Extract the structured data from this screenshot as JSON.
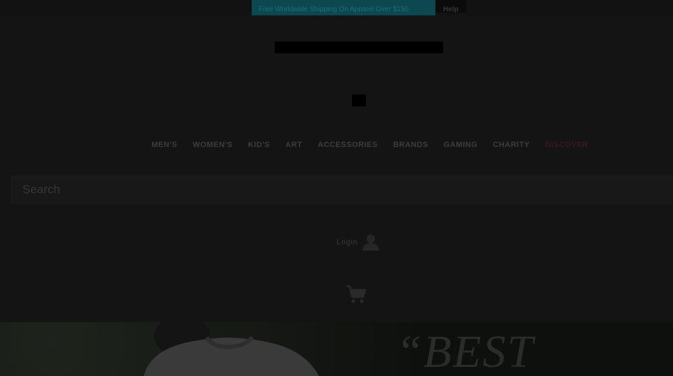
{
  "promo": {
    "text": "Free Worldwide Shipping On Apparel Over $150",
    "help_label": "Help"
  },
  "nav": {
    "items": [
      "MEN'S",
      "WOMEN'S",
      "KID'S",
      "ART",
      "ACCESSORIES",
      "BRANDS",
      "GAMING",
      "CHARITY",
      "DISCOVER"
    ]
  },
  "search": {
    "placeholder": "Search"
  },
  "account": {
    "login_label": "Login"
  },
  "hero": {
    "quote_text": "“BEST"
  },
  "colors": {
    "accent_discover": "#3a1a1f",
    "promo_bg": "#0d4850",
    "overlay": "#141414"
  }
}
